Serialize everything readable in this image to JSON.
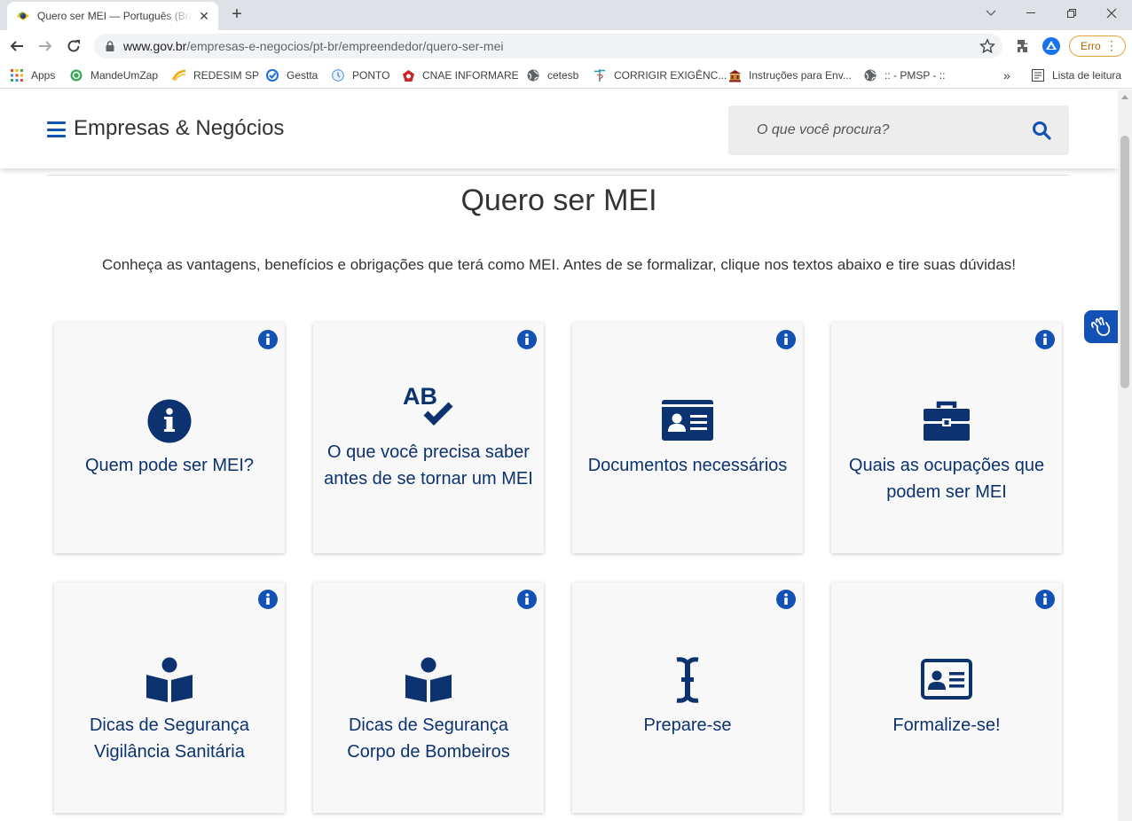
{
  "browser": {
    "tab_title": "Quero ser MEI — Português (Brasil)",
    "url_domain": "www.gov.br",
    "url_path": "/empresas-e-negocios/pt-br/empreendedor/quero-ser-mei",
    "profile_status": "Erro",
    "bookmarks": [
      {
        "label": "Apps",
        "icon": "apps-grid-icon"
      },
      {
        "label": "MandeUmZap",
        "icon": "whatsapp-icon"
      },
      {
        "label": "REDESIM SP",
        "icon": "redesim-icon"
      },
      {
        "label": "Gestta",
        "icon": "gestta-icon"
      },
      {
        "label": "PONTO",
        "icon": "clock-icon"
      },
      {
        "label": "CNAE INFORMARE",
        "icon": "informare-icon"
      },
      {
        "label": "cetesb",
        "icon": "globe-icon"
      },
      {
        "label": "CORRIGIR EXIGÊNC...",
        "icon": "caduceus-icon"
      },
      {
        "label": "Instruções para Env...",
        "icon": "building-icon"
      },
      {
        "label": ":: - PMSP - ::",
        "icon": "globe-icon"
      }
    ],
    "reading_list": "Lista de leitura"
  },
  "header": {
    "site_title": "Empresas & Negócios",
    "search_placeholder": "O que você procura?"
  },
  "page": {
    "title": "Quero ser MEI",
    "intro": "Conheça as vantagens, benefícios e obrigações que terá como MEI. Antes de se formalizar, clique nos textos abaixo e tire suas dúvidas!"
  },
  "cards": [
    {
      "label": "Quem pode ser MEI?",
      "icon": "info-circle-icon"
    },
    {
      "label": "O que você precisa saber antes de se tornar um MEI",
      "icon": "spell-check-icon"
    },
    {
      "label": "Documentos necessários",
      "icon": "id-card-icon"
    },
    {
      "label": "Quais as ocupações que podem ser MEI",
      "icon": "briefcase-icon"
    },
    {
      "label": "Dicas de Segurança Vigilância Sanitária",
      "icon": "book-reader-icon"
    },
    {
      "label": "Dicas de Segurança Corpo de Bombeiros",
      "icon": "book-reader-icon"
    },
    {
      "label": "Prepare-se",
      "icon": "text-cursor-icon"
    },
    {
      "label": "Formalize-se!",
      "icon": "address-card-icon"
    }
  ],
  "colors": {
    "primary_blue": "#1351b4",
    "dark_blue": "#0c326f",
    "card_bg": "#f8f8f8"
  }
}
